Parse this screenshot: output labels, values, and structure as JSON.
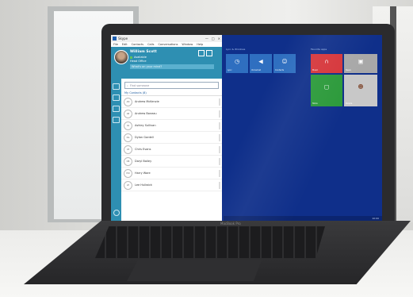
{
  "app": {
    "window_title": "Skype",
    "menu": [
      "File",
      "Edit",
      "Contacts",
      "Calls",
      "Conversations",
      "Window",
      "Help"
    ],
    "window_buttons": [
      "—",
      "□",
      "×"
    ]
  },
  "profile": {
    "name": "William Scott",
    "status": "Available",
    "location": "Head Office",
    "note_placeholder": "What's on your mind?"
  },
  "search": {
    "placeholder": "Find someone"
  },
  "tabs": {
    "group_label": "My Contacts (8)"
  },
  "contacts": [
    {
      "initials": "AM",
      "name": "Andrew McKenzie"
    },
    {
      "initials": "AB",
      "name": "Andrew Boneau"
    },
    {
      "initials": "AS",
      "name": "Ashley Sullivan"
    },
    {
      "initials": "DG",
      "name": "Dylan Gordell"
    },
    {
      "initials": "CE",
      "name": "Chris Evans"
    },
    {
      "initials": "DB",
      "name": "Daryl Bailey"
    },
    {
      "initials": "HW",
      "name": "Harry Ware"
    },
    {
      "initials": "LH",
      "name": "Lee Hullwick"
    }
  ],
  "start": {
    "group1_label": "Lync & Windows",
    "group2_label": "Favorite apps",
    "tiles": [
      {
        "label": "Lync",
        "icon": "clock-icon",
        "color": "#2f6fc0"
      },
      {
        "label": "Voicemail",
        "icon": "megaphone-icon",
        "color": "#2f6fc0"
      },
      {
        "label": "Contacts",
        "icon": "people-icon",
        "color": "#2f6fc0"
      },
      {
        "label": "Music",
        "icon": "headphones-icon",
        "color": "#d6363b"
      },
      {
        "label": "News",
        "icon": "photo-icon",
        "color": "#a8a8a8"
      },
      {
        "label": "Store",
        "icon": "bag-icon",
        "color": "#2c9a3b"
      },
      {
        "label": "People",
        "icon": "person-photo-icon",
        "color": "#c8c8c8"
      }
    ]
  },
  "laptop": {
    "brand": "MacBook Pro"
  },
  "tray": {
    "time": "10:00"
  }
}
